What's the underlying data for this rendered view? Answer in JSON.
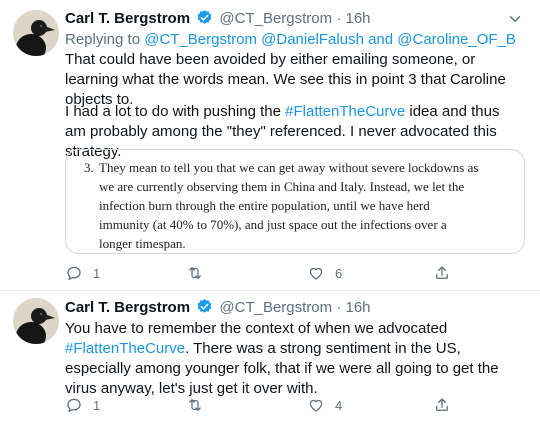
{
  "tweets": [
    {
      "author_name": "Carl T. Bergstrom",
      "handle": "@CT_Bergstrom",
      "separator": "·",
      "time": "16h",
      "reply_prefix": "Replying to",
      "reply_mentions": "@CT_Bergstrom @DanielFalush and @Caroline_OF_B",
      "paragraph1": "That could have been avoided by either emailing someone, or learning what the words mean. We see this in point 3 that Caroline objects to.",
      "paragraph2_before": "I had a lot to do with pushing the ",
      "hashtag": "#FlattenTheCurve",
      "paragraph2_after": " idea and thus am probably among the \"they\" referenced. I never advocated this strategy.",
      "quote": {
        "number": "3.",
        "lines": [
          "They mean to tell you that we can get away without severe lockdowns as",
          "we are currently observing them in China and Italy. Instead, we let the",
          "infection burn through the entire population, until we have herd",
          "immunity (at 40% to 70%), and just space out the infections over a",
          "longer timespan."
        ]
      },
      "reply_count": "1",
      "retweet_count": "",
      "like_count": "6"
    },
    {
      "author_name": "Carl T. Bergstrom",
      "handle": "@CT_Bergstrom",
      "separator": "·",
      "time": "16h",
      "text_before": "You have to remember the context of when we advocated ",
      "hashtag": "#FlattenTheCurve",
      "text_after": ". There was a strong sentiment in the US, especially among younger folk, that if we were all going to get the virus anyway, let's just get it over with.",
      "reply_count": "1",
      "retweet_count": "",
      "like_count": "4"
    }
  ],
  "icons": {
    "verified": "verified-badge-icon",
    "caret": "chevron-down-icon",
    "reply": "reply-icon",
    "retweet": "retweet-icon",
    "like": "heart-icon",
    "share": "share-icon"
  },
  "colors": {
    "accent": "#1b95e0",
    "secondary_text": "#5b7083",
    "border": "#e6ecf0"
  }
}
